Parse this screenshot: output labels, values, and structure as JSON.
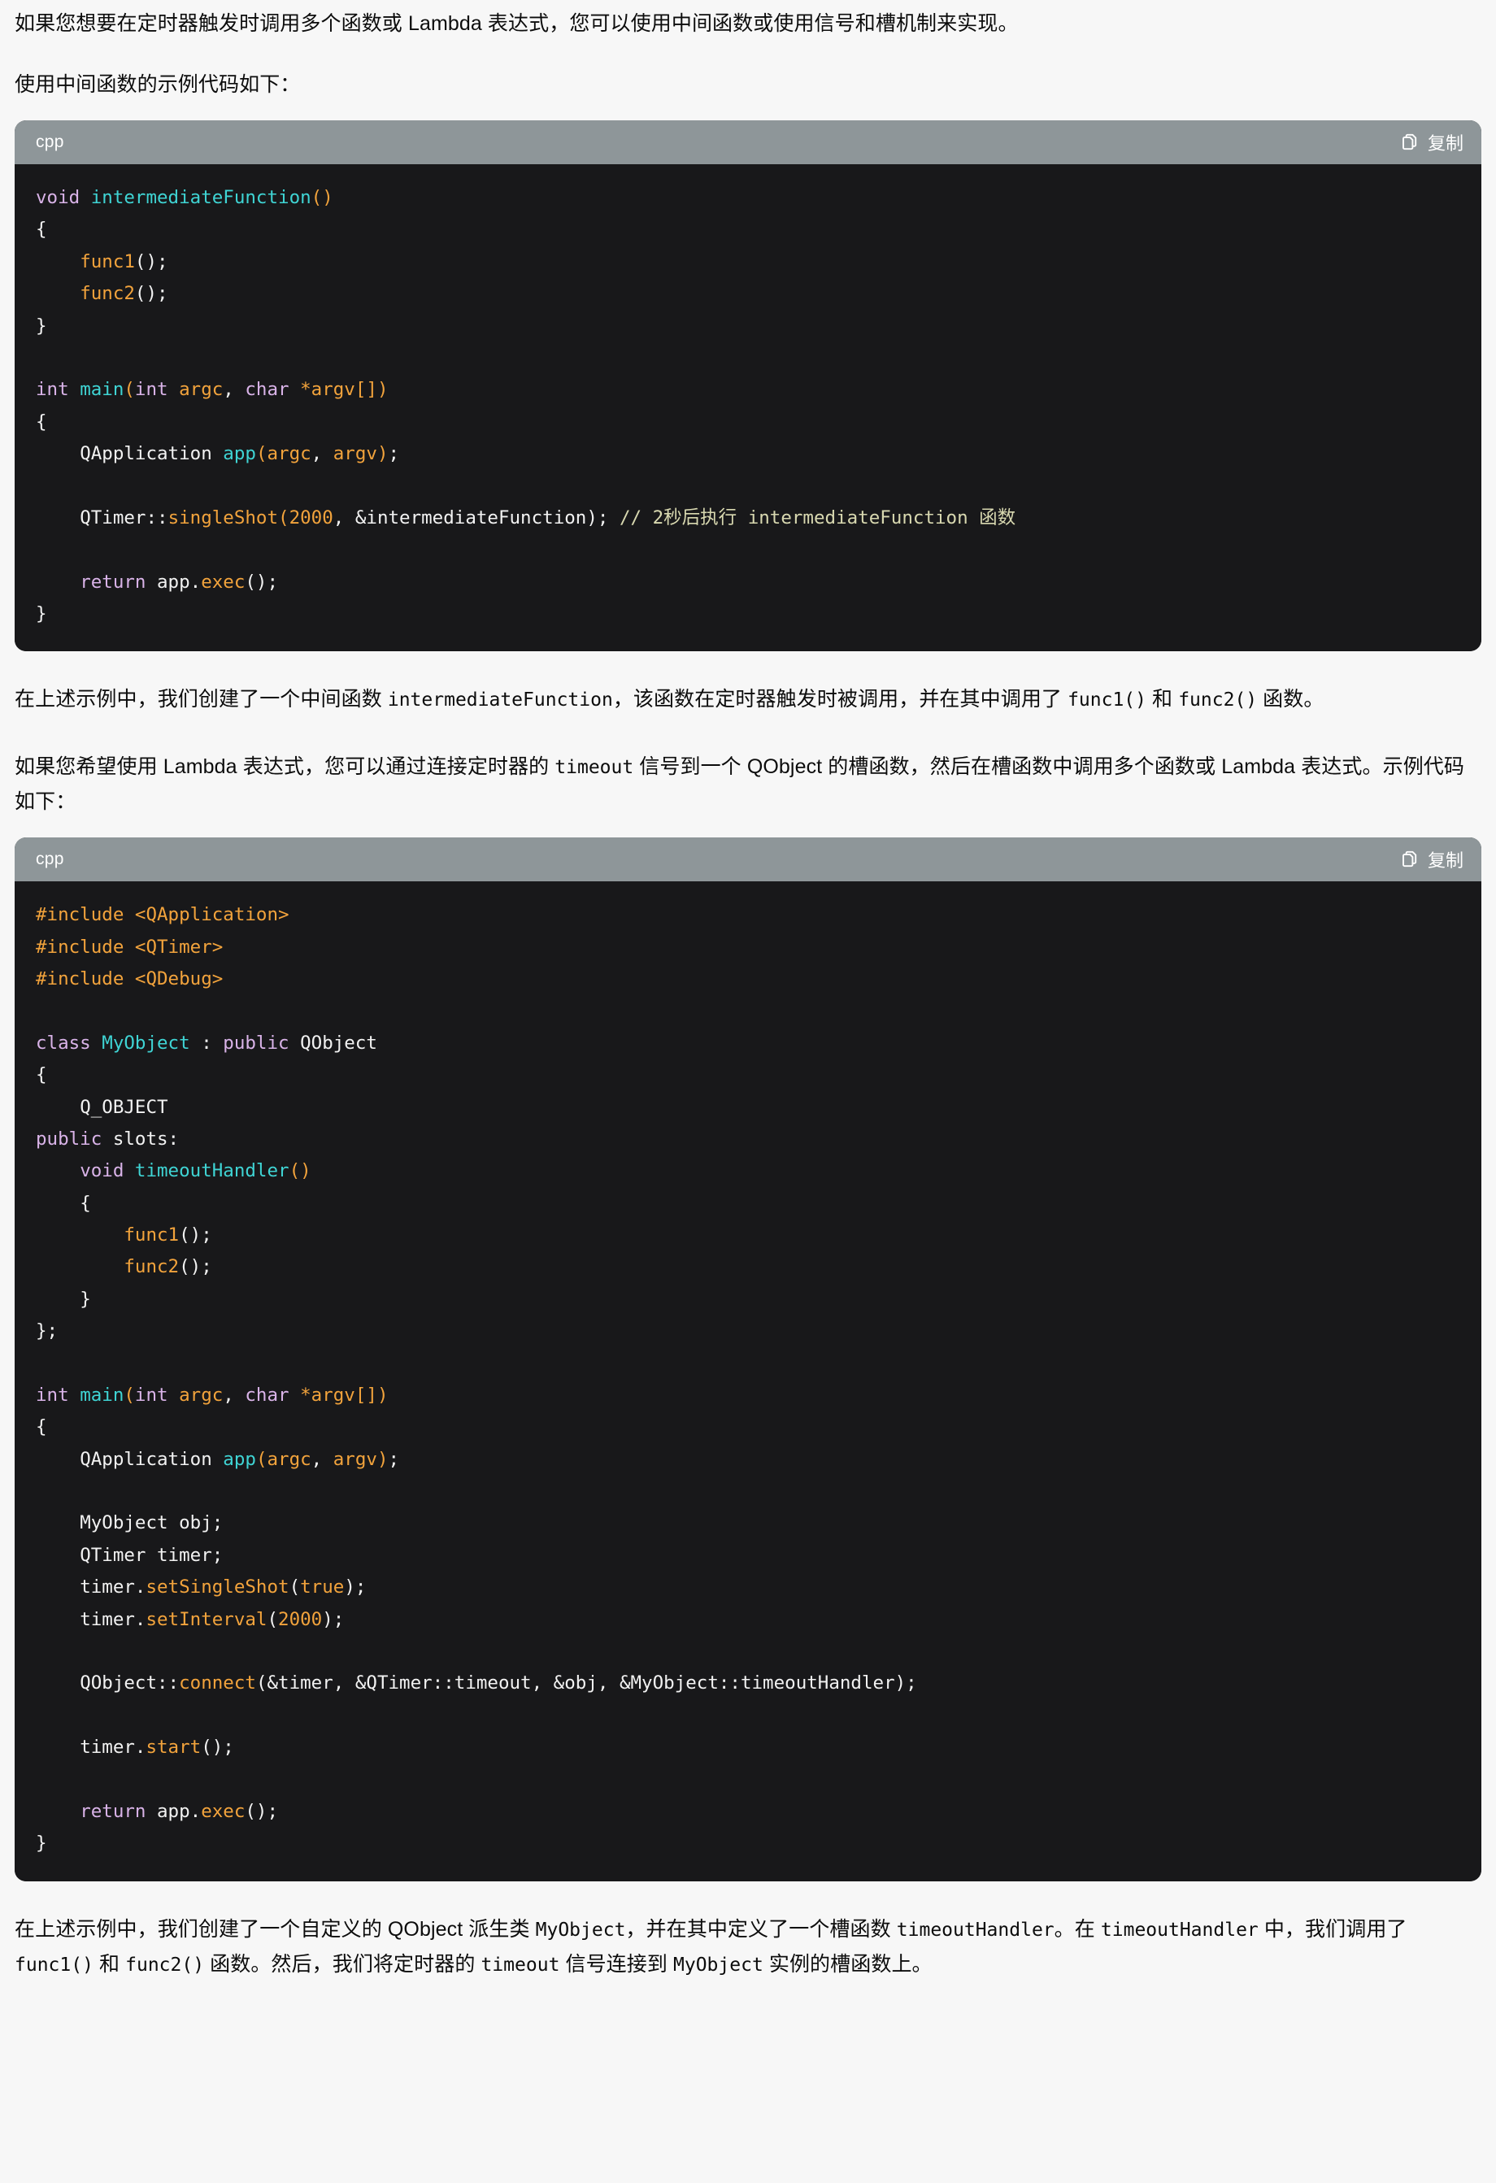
{
  "theme": {
    "page_bg": "#f7f7f7",
    "code_bg": "#18181a",
    "code_header_bg": "#8e9699",
    "text": "#0c0c0c",
    "keyword": "#d9b3e8",
    "function": "#3fd4d4",
    "operator": "#f2a33c",
    "comment": "#d8d8b0",
    "plain": "#f2f2f2"
  },
  "paragraphs": {
    "intro": "如果您想要在定时器触发时调用多个函数或 Lambda 表达式，您可以使用中间函数或使用信号和槽机制来实现。",
    "before_code1": "使用中间函数的示例代码如下：",
    "after_code1_line1": "在上述示例中，我们创建了一个中间函数 ",
    "after_code1_code1": "intermediateFunction",
    "after_code1_line2": "，该函数在定时器触发时被调用，并在其中调用了 ",
    "after_code1_code2": "func1()",
    "after_code1_line3": " 和 ",
    "after_code1_code3": "func2()",
    "after_code1_line4": " 函数。",
    "before_code2_a": "如果您希望使用 Lambda 表达式，您可以通过连接定时器的 ",
    "before_code2_code1": "timeout",
    "before_code2_b": " 信号到一个 QObject 的槽函数，然后在槽函数中调用多个函数或 Lambda 表达式。示例代码如下：",
    "after_code2_a": "在上述示例中，我们创建了一个自定义的 QObject 派生类 ",
    "after_code2_code1": "MyObject",
    "after_code2_b": "，并在其中定义了一个槽函数 ",
    "after_code2_code2": "timeoutHandler",
    "after_code2_c": "。在 ",
    "after_code2_code3": "timeoutHandler",
    "after_code2_d": " 中，我们调用了 ",
    "after_code2_code4": "func1()",
    "after_code2_e": " 和 ",
    "after_code2_code5": "func2()",
    "after_code2_f": " 函数。然后，我们将定时器的 ",
    "after_code2_code6": "timeout",
    "after_code2_g": " 信号连接到 ",
    "after_code2_code7": "MyObject",
    "after_code2_h": " 实例的槽函数上。"
  },
  "code_blocks": [
    {
      "language_label": "cpp",
      "copy_label": "复制",
      "copy_icon": "copy-icon",
      "lines": [
        "void intermediateFunction()",
        "{",
        "    func1();",
        "    func2();",
        "}",
        "",
        "int main(int argc, char *argv[])",
        "{",
        "    QApplication app(argc, argv);",
        "",
        "    QTimer::singleShot(2000, &intermediateFunction); // 2秒后执行 intermediateFunction 函数",
        "",
        "    return app.exec();",
        "}"
      ]
    },
    {
      "language_label": "cpp",
      "copy_label": "复制",
      "copy_icon": "copy-icon",
      "lines": [
        "#include <QApplication>",
        "#include <QTimer>",
        "#include <QDebug>",
        "",
        "class MyObject : public QObject",
        "{",
        "    Q_OBJECT",
        "public slots:",
        "    void timeoutHandler()",
        "    {",
        "        func1();",
        "        func2();",
        "    }",
        "};",
        "",
        "int main(int argc, char *argv[])",
        "{",
        "    QApplication app(argc, argv);",
        "",
        "    MyObject obj;",
        "    QTimer timer;",
        "    timer.setSingleShot(true);",
        "    timer.setInterval(2000);",
        "",
        "    QObject::connect(&timer, &QTimer::timeout, &obj, &MyObject::timeoutHandler);",
        "",
        "    timer.start();",
        "",
        "    return app.exec();",
        "}"
      ]
    }
  ]
}
